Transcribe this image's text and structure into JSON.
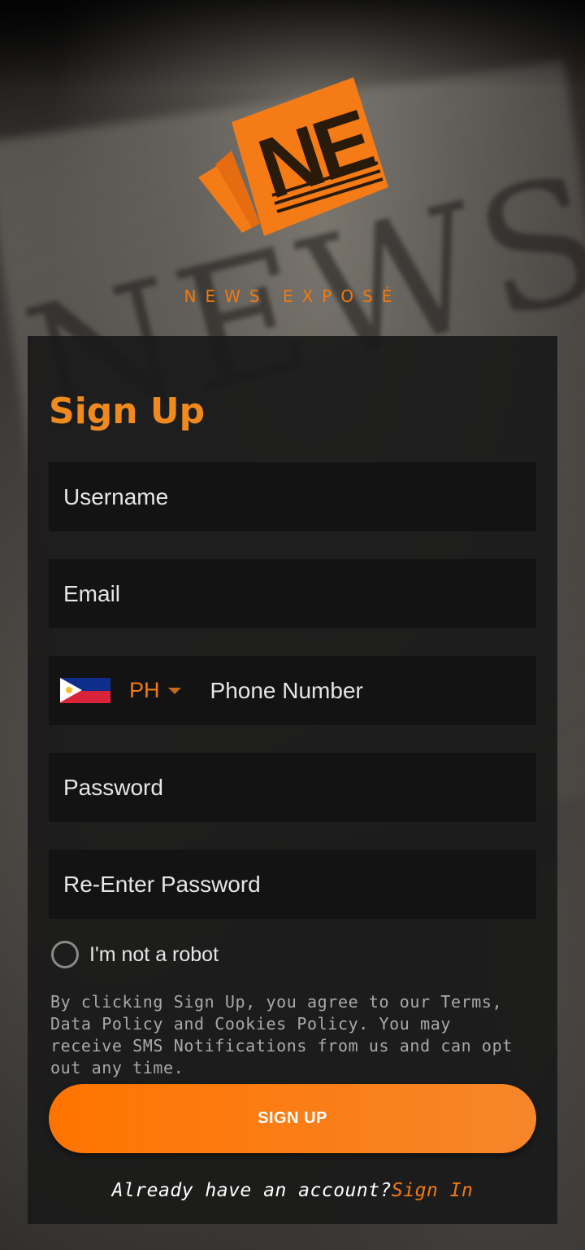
{
  "brand": {
    "logo_letters": "NE",
    "name": "NEWS EXPOSÉ",
    "accent_color": "#f07a12"
  },
  "form": {
    "title": "Sign Up",
    "username_placeholder": "Username",
    "email_placeholder": "Email",
    "phone": {
      "flag_icon": "philippines-flag-icon",
      "country_code": "PH",
      "placeholder": "Phone Number"
    },
    "password_placeholder": "Password",
    "reenter_password_placeholder": "Re-Enter Password",
    "captcha_label": "I'm not a robot",
    "terms_text": "By clicking Sign Up, you agree to our Terms, Data Policy and Cookies Policy. You may receive SMS Notifications from us and can opt out any time.",
    "submit_label": "SIGN UP"
  },
  "footer": {
    "question": "Already have an account?",
    "signin_link": "Sign In"
  }
}
